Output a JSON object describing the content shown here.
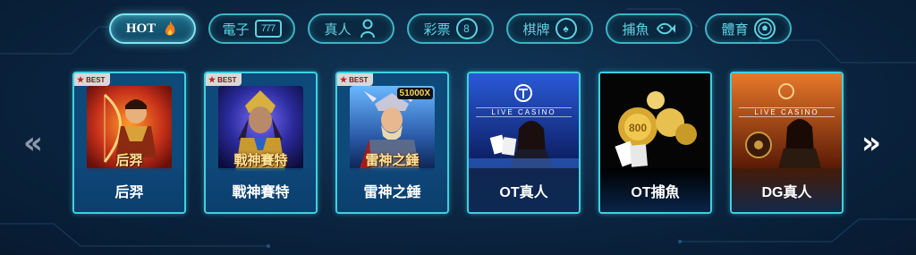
{
  "tabs": [
    {
      "label": "HOT",
      "icon": "flame-icon",
      "glyph": "🔥",
      "active": true
    },
    {
      "label": "電子",
      "icon": "slot-777-icon",
      "glyph": "777",
      "active": false
    },
    {
      "label": "真人",
      "icon": "dealer-icon",
      "glyph": "♠",
      "active": false
    },
    {
      "label": "彩票",
      "icon": "lottery-ball-icon",
      "glyph": "8",
      "active": false
    },
    {
      "label": "棋牌",
      "icon": "spade-chip-icon",
      "glyph": "♠",
      "active": false
    },
    {
      "label": "捕魚",
      "icon": "fish-icon",
      "glyph": "🦈",
      "active": false
    },
    {
      "label": "體育",
      "icon": "soccer-ball-icon",
      "glyph": "⚽",
      "active": false
    }
  ],
  "nav": {
    "prev": "«",
    "next": "»"
  },
  "best_label": "BEST",
  "cards": [
    {
      "label": "后羿",
      "art_title": "后羿",
      "best": true
    },
    {
      "label": "戰神賽特",
      "art_title": "戰神賽特",
      "best": true
    },
    {
      "label": "雷神之錘",
      "art_title": "雷神之錘",
      "best": true,
      "badge": "51000X"
    },
    {
      "label": "OT真人",
      "live_tag": "LIVE CASINO"
    },
    {
      "label": "OT捕魚"
    },
    {
      "label": "DG真人",
      "live_tag": "LIVE CASINO"
    }
  ],
  "colors": {
    "accent": "#3fd0e0",
    "background": "#0b2440",
    "card": "#0d4a7a"
  }
}
